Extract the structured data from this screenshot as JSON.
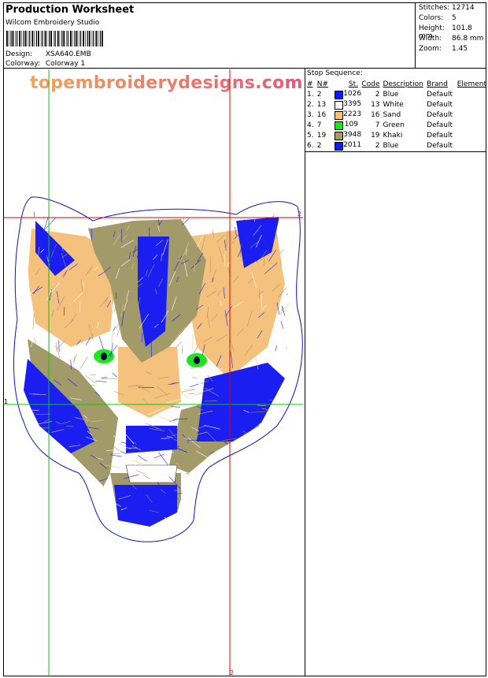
{
  "header": {
    "title": "Production Worksheet",
    "app_name": "Wilcom Embroidery Studio",
    "design_label": "Design:",
    "design_value": "XSA640.EMB",
    "colorway_label": "Colorway:",
    "colorway_value": "Colorway 1"
  },
  "stats": {
    "stitches_label": "Stitches:",
    "stitches_value": "12714",
    "colors_label": "Colors:",
    "colors_value": "5",
    "height_label": "Height:",
    "height_value": "101.8 mm",
    "width_label": "Width:",
    "width_value": "86.8 mm",
    "zoom_label": "Zoom:",
    "zoom_value": "1.45"
  },
  "stop_sequence": {
    "title": "Stop Sequence:",
    "headers": [
      "#",
      "N#",
      "St.",
      "Code",
      "Description",
      "Brand",
      "Element"
    ],
    "rows": [
      {
        "num": "1.",
        "n": "2",
        "color": "#0a1ef0",
        "st": "1026",
        "code": "2",
        "desc": "Blue",
        "brand": "Default"
      },
      {
        "num": "2.",
        "n": "13",
        "color": "#ffffff",
        "st": "3395",
        "code": "13",
        "desc": "White",
        "brand": "Default"
      },
      {
        "num": "3.",
        "n": "16",
        "color": "#f5c27e",
        "st": "2223",
        "code": "16",
        "desc": "Sand",
        "brand": "Default"
      },
      {
        "num": "4.",
        "n": "7",
        "color": "#18e818",
        "st": "109",
        "code": "7",
        "desc": "Green",
        "brand": "Default"
      },
      {
        "num": "5.",
        "n": "19",
        "color": "#a39a6a",
        "st": "3948",
        "code": "19",
        "desc": "Khaki",
        "brand": "Default"
      },
      {
        "num": "6.",
        "n": "2",
        "color": "#0a1ef0",
        "st": "2011",
        "code": "2",
        "desc": "Blue",
        "brand": "Default"
      }
    ]
  },
  "watermark": {
    "text": "topembroiderydesigns.com",
    "color_start": "#f2a35a",
    "color_end": "#e8567a"
  },
  "markers": {
    "one": "1",
    "two": "2"
  },
  "colors": {
    "guide_green": "#00cc00",
    "guide_red": "#e00000",
    "outline_blue": "#1010d0",
    "blue": "#1a1ef0",
    "khaki": "#a39a6a",
    "sand": "#f5c27e",
    "green": "#18e818"
  }
}
